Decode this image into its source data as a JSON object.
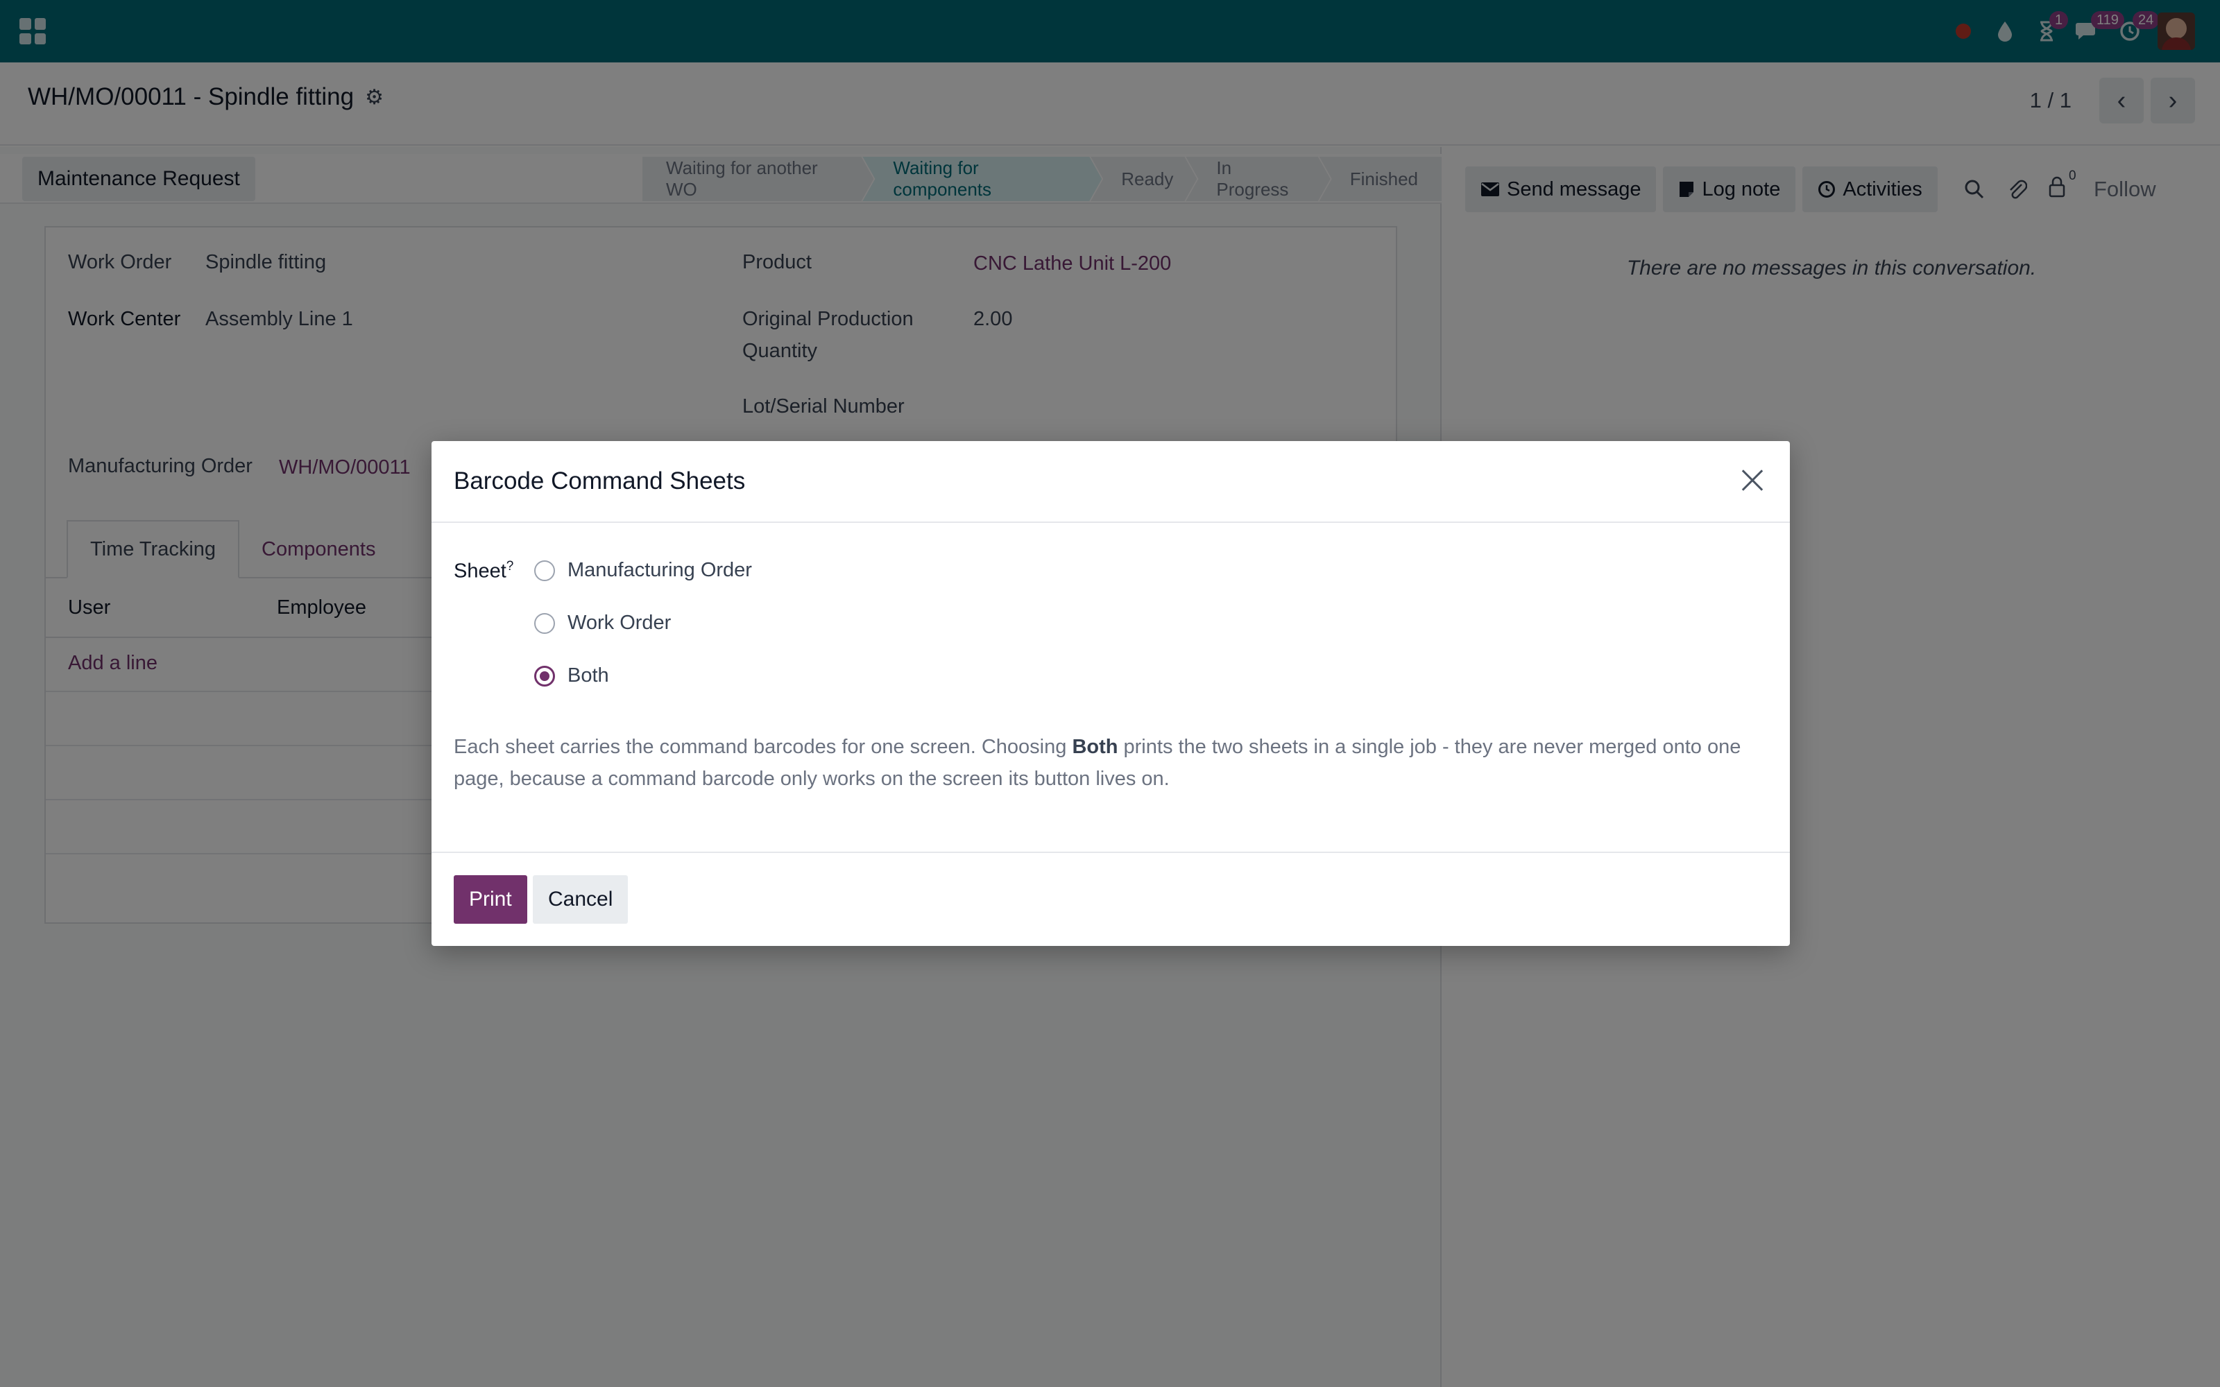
{
  "navbar": {
    "badges": {
      "activities": "1",
      "messages": "119",
      "clock": "24"
    },
    "colors": {
      "brand": "#016a77",
      "accent": "#71316b",
      "badge": "#8f3f86"
    }
  },
  "control": {
    "title": "WH/MO/00011 - Spindle fitting",
    "pager": "1 / 1"
  },
  "statusbar": {
    "button": "Maintenance Request",
    "stages": [
      "Waiting for another WO",
      "Waiting for components",
      "Ready",
      "In Progress",
      "Finished"
    ],
    "active_stage": "Waiting for components"
  },
  "form": {
    "work_order_label": "Work Order",
    "work_order_value": "Spindle fitting",
    "work_center_label": "Work Center",
    "work_center_value": "Assembly Line 1",
    "product_label": "Product",
    "product_value": "CNC Lathe Unit L-200",
    "qty_label_1": "Original Production",
    "qty_label_2": "Quantity",
    "qty_value": "2.00",
    "lot_label": "Lot/Serial Number",
    "mo_label": "Manufacturing Order",
    "mo_value": "WH/MO/00011",
    "tabs": [
      "Time Tracking",
      "Components"
    ],
    "columns": [
      "User",
      "Employee"
    ],
    "add_line": "Add a line"
  },
  "chatter": {
    "send_message": "Send message",
    "log_note": "Log note",
    "activities": "Activities",
    "followers_count": "0",
    "follow": "Follow",
    "empty": "There are no messages in this conversation."
  },
  "modal": {
    "title": "Barcode Command Sheets",
    "field_label": "Sheet",
    "help_mark": "?",
    "options": [
      "Manufacturing Order",
      "Work Order",
      "Both"
    ],
    "selected": "Both",
    "help_pre": "Each sheet carries the command barcodes for one screen. Choosing ",
    "help_bold": "Both",
    "help_post": " prints the two sheets in a single job - they are never merged onto one page, because a command barcode only works on the screen its button lives on.",
    "print": "Print",
    "cancel": "Cancel"
  }
}
